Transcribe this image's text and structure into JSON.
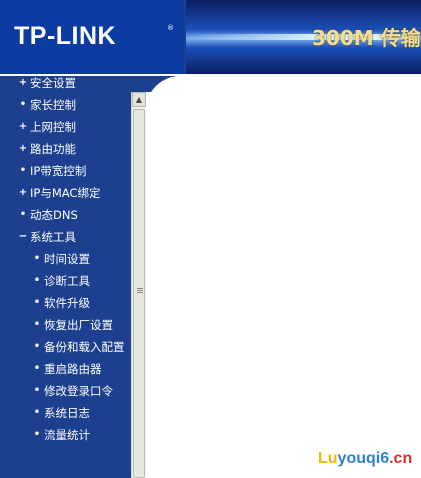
{
  "header": {
    "logo_text": "TP-LINK",
    "logo_mark": "®",
    "banner_text": "300M 传输"
  },
  "sidebar": {
    "items": [
      {
        "label": "安全设置",
        "bullet": "+",
        "level": "top"
      },
      {
        "label": "家长控制",
        "bullet": "•",
        "level": "top"
      },
      {
        "label": "上网控制",
        "bullet": "+",
        "level": "top"
      },
      {
        "label": "路由功能",
        "bullet": "+",
        "level": "top"
      },
      {
        "label": "IP带宽控制",
        "bullet": "•",
        "level": "top"
      },
      {
        "label": "IP与MAC绑定",
        "bullet": "+",
        "level": "top"
      },
      {
        "label": "动态DNS",
        "bullet": "•",
        "level": "top"
      },
      {
        "label": "系统工具",
        "bullet": "−",
        "level": "top"
      },
      {
        "label": "时间设置",
        "bullet": "•",
        "level": "sub"
      },
      {
        "label": "诊断工具",
        "bullet": "•",
        "level": "sub"
      },
      {
        "label": "软件升级",
        "bullet": "•",
        "level": "sub"
      },
      {
        "label": "恢复出厂设置",
        "bullet": "•",
        "level": "sub"
      },
      {
        "label": "备份和载入配置",
        "bullet": "•",
        "level": "sub"
      },
      {
        "label": "重启路由器",
        "bullet": "•",
        "level": "sub"
      },
      {
        "label": "修改登录口令",
        "bullet": "•",
        "level": "sub"
      },
      {
        "label": "系统日志",
        "bullet": "•",
        "level": "sub"
      },
      {
        "label": "流量统计",
        "bullet": "•",
        "level": "sub"
      }
    ]
  },
  "scrollbar": {
    "up_arrow": "▲"
  },
  "watermark": {
    "part1": "Lu",
    "part2": "youqi6",
    "part3": ".cn"
  },
  "colors": {
    "sidebar_bg": "#1d3f8f",
    "logo_bg": "#0b3aa0",
    "banner_text": "#f1dd93"
  }
}
